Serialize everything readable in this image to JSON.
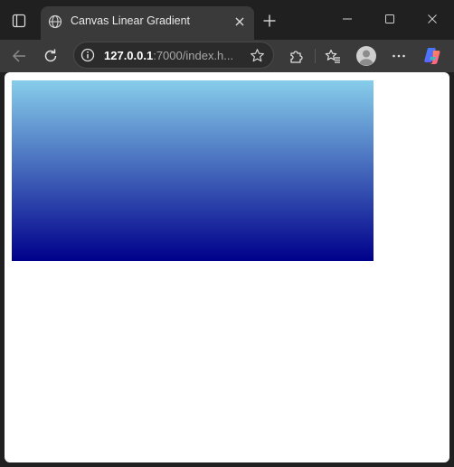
{
  "browser": {
    "tab": {
      "title": "Canvas Linear Gradient",
      "favicon_icon": "globe-icon",
      "close_icon": "close-icon"
    },
    "new_tab_icon": "plus-icon",
    "window_controls": [
      "minimize-icon",
      "maximize-icon",
      "close-icon"
    ]
  },
  "toolbar": {
    "back_icon": "arrow-left-icon",
    "reload_icon": "reload-icon",
    "address": {
      "info_icon": "info-icon",
      "host": "127.0.0.1",
      "rest": ":7000/index.h...",
      "favorite_icon": "star-icon"
    },
    "extensions_icon": "puzzle-icon",
    "favorites_icon": "favorites-icon",
    "profile_icon": "avatar-icon",
    "menu_icon": "more-icon",
    "copilot_icon": "copilot-icon"
  },
  "page": {
    "gradient": {
      "start_color": "#87ceeb",
      "end_color": "#00008b",
      "direction": "top-to-bottom"
    }
  }
}
